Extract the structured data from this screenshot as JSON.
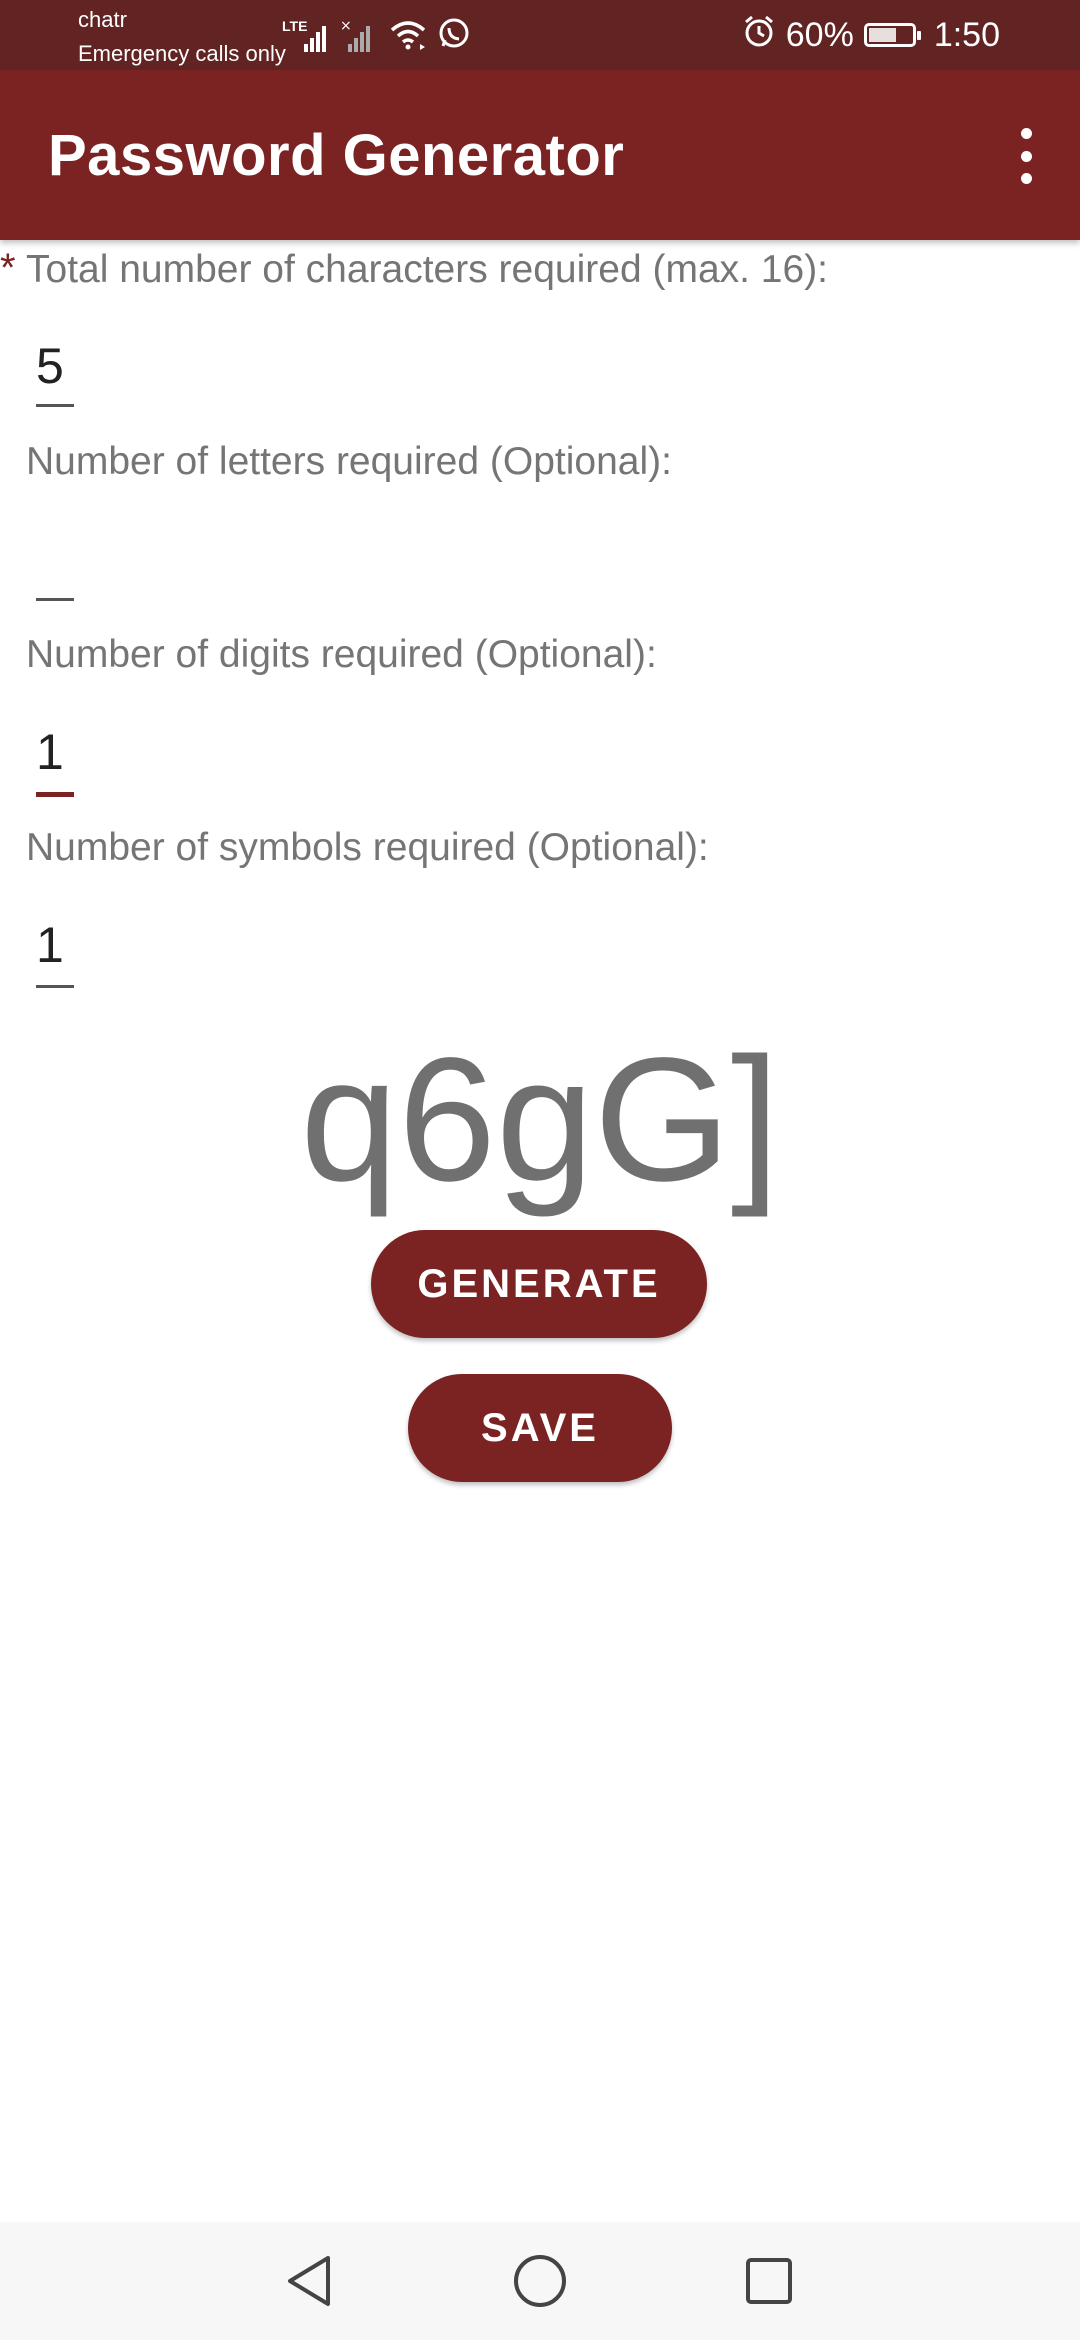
{
  "status_bar": {
    "carrier": "chatr",
    "network_status": "Emergency calls only",
    "network_type": "LTE",
    "battery_percent": "60%",
    "battery_level": 0.6,
    "time": "1:50",
    "icons": [
      "lte-signal-icon",
      "no-signal-icon",
      "wifi-icon",
      "whatsapp-icon",
      "alarm-icon",
      "battery-icon"
    ]
  },
  "app_bar": {
    "title": "Password Generator",
    "menu_icon": "overflow-menu-icon"
  },
  "form": {
    "required_marker": "*",
    "total_label": "Total number of characters required (max. 16):",
    "total_value": "5",
    "letters_label": "Number of letters required (Optional):",
    "letters_value": "",
    "digits_label": "Number of digits required (Optional):",
    "digits_value": "1",
    "symbols_label": "Number of symbols required (Optional):",
    "symbols_value": "1"
  },
  "result": {
    "password": "q6gG]"
  },
  "actions": {
    "generate_label": "GENERATE",
    "save_label": "SAVE"
  },
  "nav_bar": {
    "icons": [
      "back-icon",
      "home-icon",
      "recents-icon"
    ]
  },
  "colors": {
    "status_bar": "#622323",
    "app_bar": "#7b2222",
    "accent": "#7b2222",
    "label_text": "#757575",
    "password_text": "#707070"
  }
}
